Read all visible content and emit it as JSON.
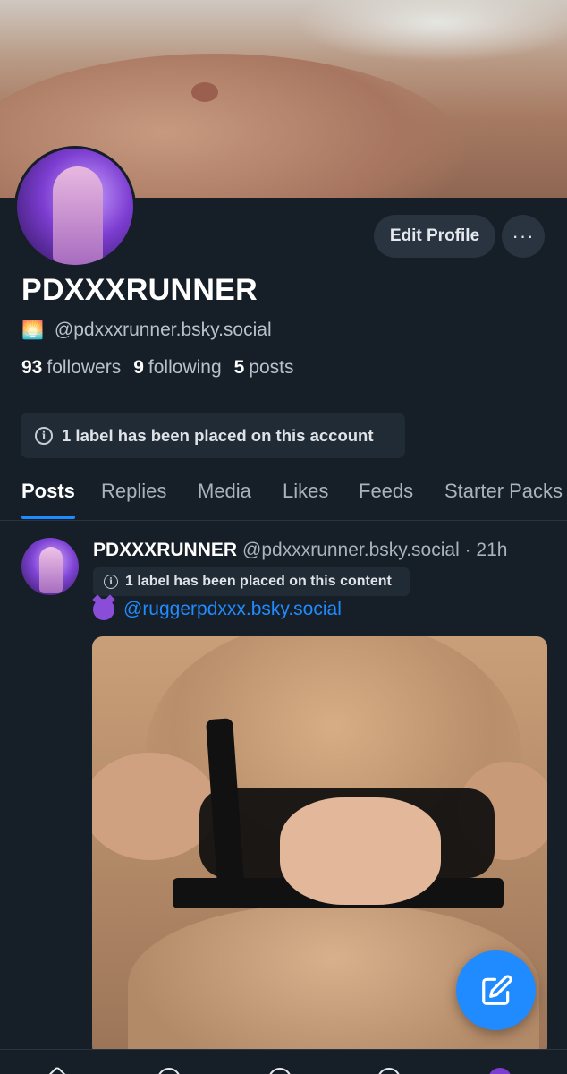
{
  "profile": {
    "display_name": "PDXXXRUNNER",
    "status_emoji": "🌅",
    "handle": "@pdxxxrunner.bsky.social",
    "followers_count": "93",
    "followers_label": "followers",
    "following_count": "9",
    "following_label": "following",
    "posts_count": "5",
    "posts_label": "posts",
    "account_label_notice": "1 label has been placed on this account"
  },
  "actions": {
    "edit_profile": "Edit Profile",
    "more": "···"
  },
  "tabs": [
    "Posts",
    "Replies",
    "Media",
    "Likes",
    "Feeds",
    "Starter Packs"
  ],
  "active_tab": "Posts",
  "post": {
    "author_name": "PDXXXRUNNER",
    "author_handle": "@pdxxxrunner.bsky.social",
    "time": "· 21h",
    "content_label_notice": "1 label has been placed on this content",
    "mention": "@ruggerpdxxx.bsky.social",
    "emoji_icon": "smiling-devil-icon"
  },
  "colors": {
    "background": "#161e27",
    "accent": "#208bfe",
    "pill": "#212b36",
    "button": "#2a3441"
  },
  "icons": {
    "info": "info-circle-icon",
    "compose": "compose-pencil-icon",
    "more": "ellipsis-icon"
  }
}
